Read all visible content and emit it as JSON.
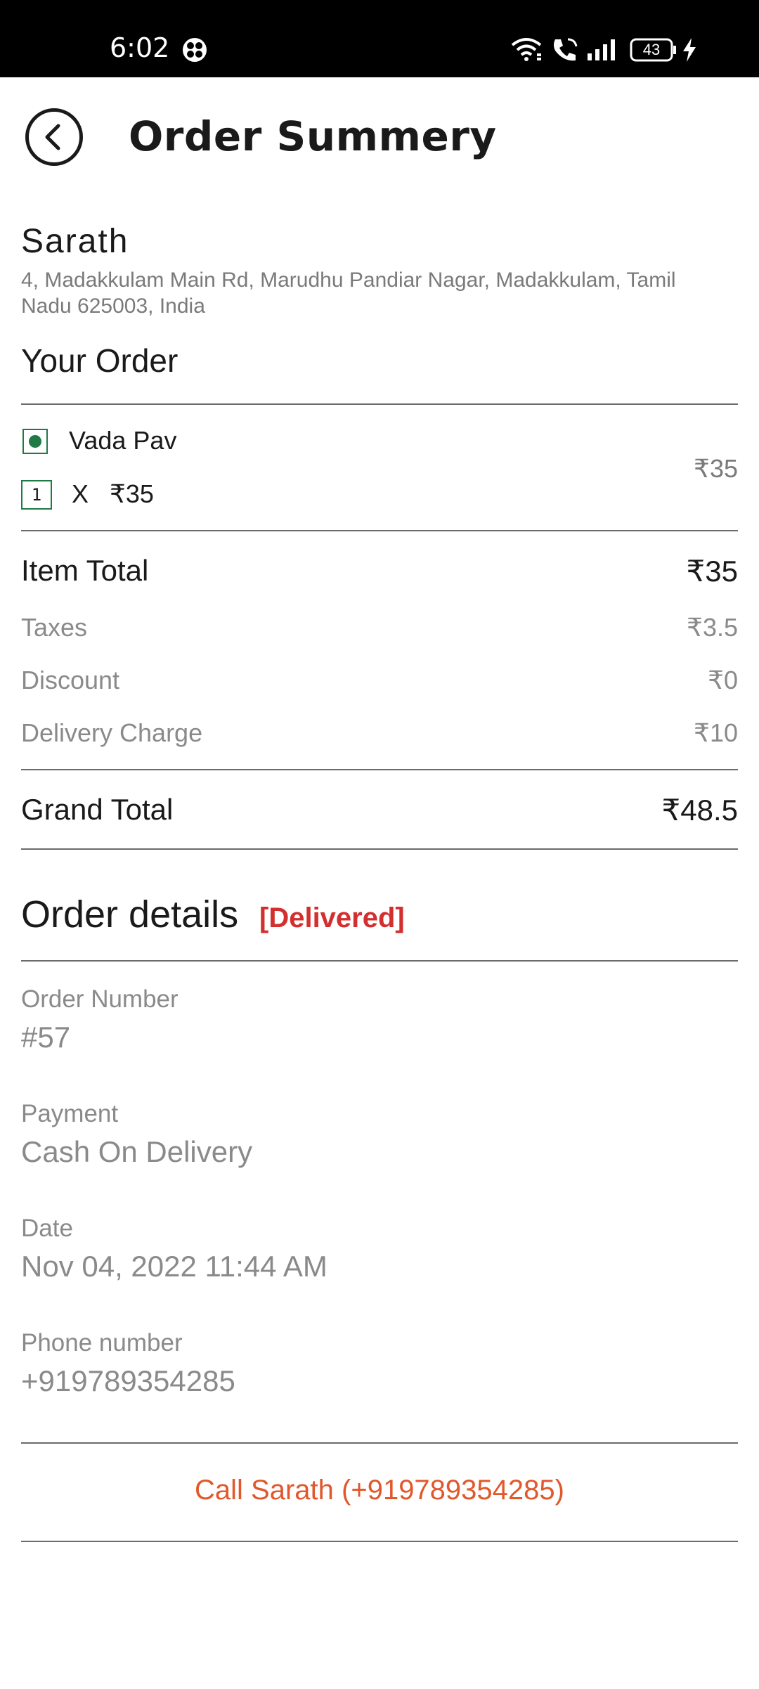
{
  "status_bar": {
    "time": "6:02",
    "battery": "43",
    "icons": [
      "android-system-icon",
      "wifi-icon",
      "wifi-calling-icon",
      "signal-icon",
      "battery-icon",
      "charging-bolt-icon"
    ]
  },
  "header": {
    "back_icon": "chevron-left-icon",
    "title": "Order Summery"
  },
  "customer": {
    "name": "Sarath",
    "address": "4, Madakkulam Main Rd, Marudhu Pandiar Nagar, Madakkulam, Tamil Nadu 625003, India"
  },
  "your_order": {
    "heading": "Your Order",
    "items": [
      {
        "name": "Vada Pav",
        "veg_icon": "veg-indicator-icon",
        "quantity": "1",
        "times": "X",
        "unit_price": "₹35",
        "total": "₹35"
      }
    ]
  },
  "bill": {
    "item_total_label": "Item Total",
    "item_total_value": "₹35",
    "taxes_label": "Taxes",
    "taxes_value": "₹3.5",
    "discount_label": "Discount",
    "discount_value": "₹0",
    "delivery_label": "Delivery Charge",
    "delivery_value": "₹10",
    "grand_total_label": "Grand Total",
    "grand_total_value": "₹48.5"
  },
  "order_details": {
    "heading": "Order details",
    "status": "[Delivered]",
    "order_number_label": "Order Number",
    "order_number_value": "#57",
    "payment_label": "Payment",
    "payment_value": "Cash On Delivery",
    "date_label": "Date",
    "date_value": "Nov 04, 2022 11:44 AM",
    "phone_label": "Phone number",
    "phone_value": "+919789354285"
  },
  "call_action": {
    "label": "Call Sarath (+919789354285)"
  },
  "colors": {
    "status_delivered": "#d32f2f",
    "call_link": "#e0582b",
    "veg_green": "#1f7a45",
    "muted_text": "#8a8a8a"
  }
}
